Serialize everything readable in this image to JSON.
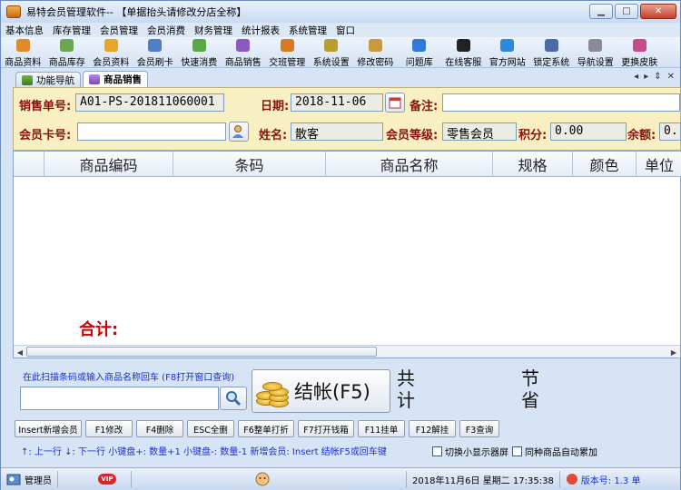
{
  "window": {
    "title": "易特会员管理软件-- 【单据抬头请修改分店全称】"
  },
  "menu": [
    "基本信息",
    "库存管理",
    "会员管理",
    "会员消费",
    "财务管理",
    "统计报表",
    "系统管理",
    "窗口"
  ],
  "toolbar": [
    {
      "label": "商品资料",
      "icon": "product-info-icon",
      "color": "#e08a2a"
    },
    {
      "label": "商品库存",
      "icon": "inventory-icon",
      "color": "#6aa84f"
    },
    {
      "label": "会员资料",
      "icon": "member-info-icon",
      "color": "#e7a628"
    },
    {
      "label": "会员刷卡",
      "icon": "card-swipe-icon",
      "color": "#4f7fc8"
    },
    {
      "label": "快速消费",
      "icon": "quick-consume-icon",
      "color": "#58a845"
    },
    {
      "label": "商品销售",
      "icon": "product-sale-icon",
      "color": "#8a5ac0"
    },
    {
      "label": "交班管理",
      "icon": "shift-icon",
      "color": "#d87a20"
    },
    {
      "label": "系统设置",
      "icon": "settings-icon",
      "color": "#b8a028"
    },
    {
      "label": "修改密码",
      "icon": "password-icon",
      "color": "#c89a40"
    },
    {
      "label": "问题库",
      "icon": "faq-icon",
      "color": "#2f7ad8"
    },
    {
      "label": "在线客服",
      "icon": "qq-icon",
      "color": "#222222"
    },
    {
      "label": "官方网站",
      "icon": "ie-icon",
      "color": "#2a8ae0"
    },
    {
      "label": "锁定系统",
      "icon": "lock-icon",
      "color": "#4a6aa8"
    },
    {
      "label": "导航设置",
      "icon": "nav-settings-icon",
      "color": "#8a8a9a"
    },
    {
      "label": "更换皮肤",
      "icon": "skin-icon",
      "color": "#c84a8a"
    }
  ],
  "tabs": [
    {
      "label": "功能导航",
      "active": false
    },
    {
      "label": "商品销售",
      "active": true
    }
  ],
  "tabnav": {
    "left": "◂",
    "right": "▸",
    "pin": "⇕",
    "close": "✕"
  },
  "form": {
    "order_no_label": "销售单号:",
    "order_no": "A01-PS-201811060001",
    "date_label": "日期:",
    "date": "2018-11-06",
    "remark_label": "备注:",
    "remark": "",
    "card_label": "会员卡号:",
    "card": "",
    "name_label": "姓名:",
    "name": "散客",
    "level_label": "会员等级:",
    "level": "零售会员",
    "points_label": "积分:",
    "points": "0.00",
    "balance_label": "余额:",
    "balance": "0."
  },
  "grid": {
    "columns": [
      "",
      "商品编码",
      "条码",
      "商品名称",
      "规格",
      "颜色",
      "单位"
    ],
    "total_label": "合计:"
  },
  "scan": {
    "label": "在此扫描条码或输入商品名称回车 (F8打开窗口查询)",
    "value": ""
  },
  "checkout": {
    "label": "结帐(F5)"
  },
  "summary": {
    "total": "共计",
    "saved": "节省"
  },
  "fkeys": [
    "Insert新增会员",
    "F1修改",
    "F4删除",
    "ESC全删",
    "F6整单打折",
    "F7打开钱箱",
    "F11挂单",
    "F12解挂",
    "F3查询"
  ],
  "hints": "↑: 上一行   ↓: 下一行   小键盘+: 数量+1   小键盘-: 数量-1   新增会员: Insert   结帐F5或回车键",
  "checks": [
    {
      "label": "切换小显示器屏"
    },
    {
      "label": "同种商品自动累加"
    }
  ],
  "status": {
    "user": "管理员",
    "vip": "VIP",
    "datetime": "2018年11月6日  星期二  17:35:38",
    "version": "版本号: 1.3  单"
  }
}
